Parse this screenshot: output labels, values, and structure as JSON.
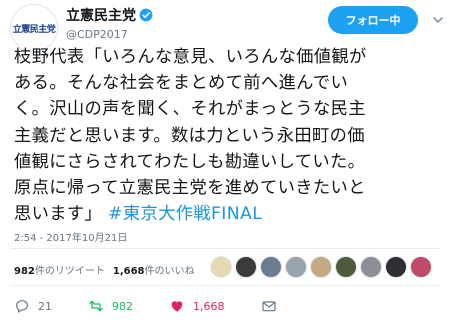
{
  "user": {
    "display_name": "立憲民主党",
    "handle": "@CDP2017",
    "avatar_logo_text": "立憲民主党"
  },
  "follow_button": {
    "label": "フォロー中"
  },
  "tweet": {
    "text": "枝野代表「いろんな意見、いろんな価値観が\nある。そんな社会をまとめて前へ進んでい\nく。沢山の声を聞く、それがまっとうな民主\n主義だと思います。数は力という永田町の価\n値観にさらされてわたしも勘違いしていた。\n原点に帰って立憲民主党を進めていきたいと\n思います」",
    "hashtag": "#東京大作戦FINAL",
    "timestamp": "2:54 - 2017年10月21日"
  },
  "stats": {
    "retweets_count": "982",
    "retweets_label": "件のリツイート",
    "likes_count": "1,668",
    "likes_label": "件のいいね"
  },
  "liker_avatar_colors": [
    "#e8d9b5",
    "#3b3b3b",
    "#6a7c8f",
    "#9aa4ad",
    "#c4a982",
    "#4d5c3a",
    "#8b8f96",
    "#2f2f36",
    "#c04a6a"
  ],
  "actions": {
    "reply_count": "21",
    "retweet_count": "982",
    "like_count": "1,668"
  },
  "colors": {
    "accent": "#1da1f2",
    "hashtag": "#1b95e0",
    "retweet": "#17bf63",
    "like": "#e0245e",
    "verified": "#1da1f2"
  }
}
